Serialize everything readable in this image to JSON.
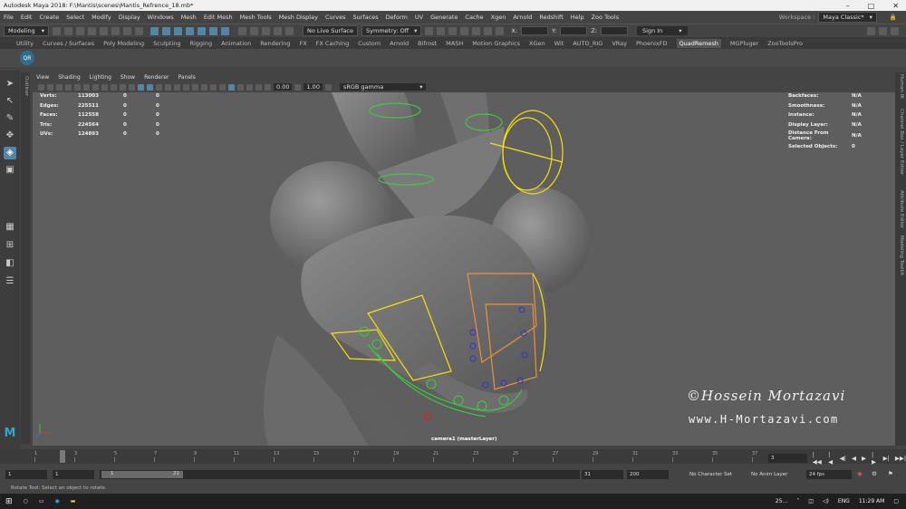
{
  "title": "Autodesk Maya 2018: F:\\Mantis\\scenes\\Mantis_Refrence_18.mb*",
  "menus": [
    "File",
    "Edit",
    "Create",
    "Select",
    "Modify",
    "Display",
    "Windows",
    "Mesh",
    "Edit Mesh",
    "Mesh Tools",
    "Mesh Display",
    "Curves",
    "Surfaces",
    "Deform",
    "UV",
    "Generate",
    "Cache",
    "Xgen",
    "Arnold",
    "Redshift",
    "Help",
    "Zoo Tools"
  ],
  "workspace": {
    "label": "Workspace :",
    "value": "Maya Classic*"
  },
  "status": {
    "mode": "Modeling",
    "live_surface": "No Live Surface",
    "symmetry": "Symmetry: Off",
    "field_x": "X:",
    "field_y": "Y:",
    "field_z": "Z:",
    "signin": "Sign In"
  },
  "shelf_tabs": [
    "Utility",
    "Curves / Surfaces",
    "Poly Modeling",
    "Sculpting",
    "Rigging",
    "Animation",
    "Rendering",
    "FX",
    "FX Caching",
    "Custom",
    "Arnold",
    "Bifrost",
    "MASH",
    "Motion Graphics",
    "XGen",
    "Wit",
    "AUTO_RIG",
    "VRay",
    "PhoenixFD",
    "QuadRemesh",
    "MGPluger",
    "ZooToolsPro"
  ],
  "active_shelf": "QuadRemesh",
  "shelf_icon": "QR",
  "panel_menu": [
    "View",
    "Shading",
    "Lighting",
    "Show",
    "Renderer",
    "Panels"
  ],
  "panel_toolbar": {
    "value1": "0.00",
    "value2": "1.00",
    "color_space": "sRGB gamma"
  },
  "hud_left": [
    {
      "k": "Verts:",
      "v": "113003",
      "a": "0",
      "b": "0"
    },
    {
      "k": "Edges:",
      "v": "225511",
      "a": "0",
      "b": "0"
    },
    {
      "k": "Faces:",
      "v": "112558",
      "a": "0",
      "b": "0"
    },
    {
      "k": "Tris:",
      "v": "224564",
      "a": "0",
      "b": "0"
    },
    {
      "k": "UVs:",
      "v": "124893",
      "a": "0",
      "b": "0"
    }
  ],
  "hud_right": [
    {
      "k": "Backfaces:",
      "v": "N/A"
    },
    {
      "k": "Smoothness:",
      "v": "N/A"
    },
    {
      "k": "Instance:",
      "v": "N/A"
    },
    {
      "k": "Display Layer:",
      "v": "N/A"
    },
    {
      "k": "Distance From Camera:",
      "v": "N/A"
    },
    {
      "k": "Selected Objects:",
      "v": "0"
    }
  ],
  "camera_label": "camera1 (masterLayer)",
  "watermark": {
    "line1": "©Hossein Mortazavi",
    "line2": "www.H-Mortazavi.com"
  },
  "side_tabs": {
    "outliner": "Outliner",
    "right": [
      "Channel Box / Layer Editor",
      "Attribute Editor",
      "Modeling Toolkit",
      "Human IK"
    ]
  },
  "timeline": {
    "ticks": [
      "1",
      "3",
      "5",
      "7",
      "9",
      "11",
      "13",
      "15",
      "17",
      "19",
      "21",
      "23",
      "25",
      "27",
      "29",
      "31",
      "33",
      "35",
      "37"
    ],
    "current_frame": "3"
  },
  "range": {
    "start": "1",
    "start2": "1",
    "slider_start": "1",
    "slider_end": "21",
    "end": "31",
    "end2": "200",
    "character_set": "No Character Set",
    "anim_layer": "No Anim Layer",
    "fps": "24 fps"
  },
  "help_line": "Rotate Tool: Select an object to rotate.",
  "taskbar": {
    "weather": "25...",
    "lang": "ENG",
    "time": "11:29 AM"
  },
  "colors": {
    "selection_yellow": "#f5e10a",
    "control_green": "#3fc93f",
    "control_orange": "#e8923a",
    "accent_blue": "#5285a6"
  }
}
